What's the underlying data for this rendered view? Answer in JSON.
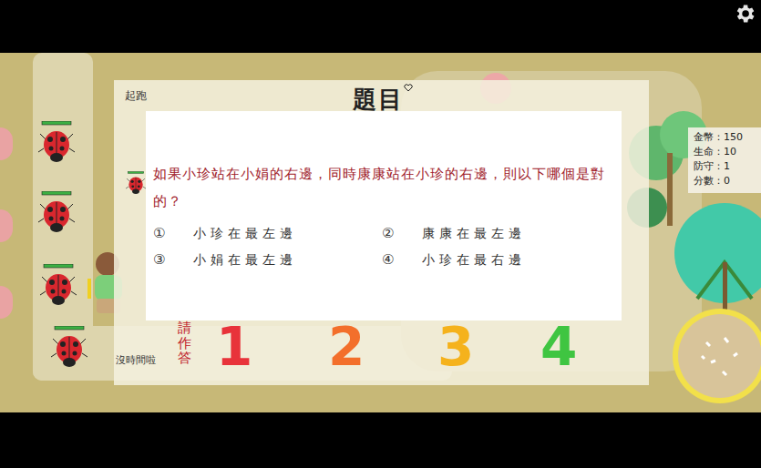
{
  "dialog": {
    "title": "題目",
    "start_label": "起跑",
    "timeout_label": "沒時間啦",
    "prompt_label": "請作答"
  },
  "question": {
    "text": "如果小珍站在小娟的右邊，同時康康站在小珍的右邊，則以下哪個是對的？",
    "options": [
      {
        "number": "①",
        "text": "小珍在最左邊"
      },
      {
        "number": "②",
        "text": "康康在最左邊"
      },
      {
        "number": "③",
        "text": "小娟在最左邊"
      },
      {
        "number": "④",
        "text": "小珍在最右邊"
      }
    ]
  },
  "answers": [
    {
      "label": "1",
      "color": "#e8333a"
    },
    {
      "label": "2",
      "color": "#f36f2b"
    },
    {
      "label": "3",
      "color": "#f5b21c"
    },
    {
      "label": "4",
      "color": "#3fc541"
    }
  ],
  "stats": [
    {
      "label": "金幣：",
      "value": "150"
    },
    {
      "label": "生命：",
      "value": "10"
    },
    {
      "label": "防守：",
      "value": "1"
    },
    {
      "label": "分數：",
      "value": "0"
    }
  ]
}
